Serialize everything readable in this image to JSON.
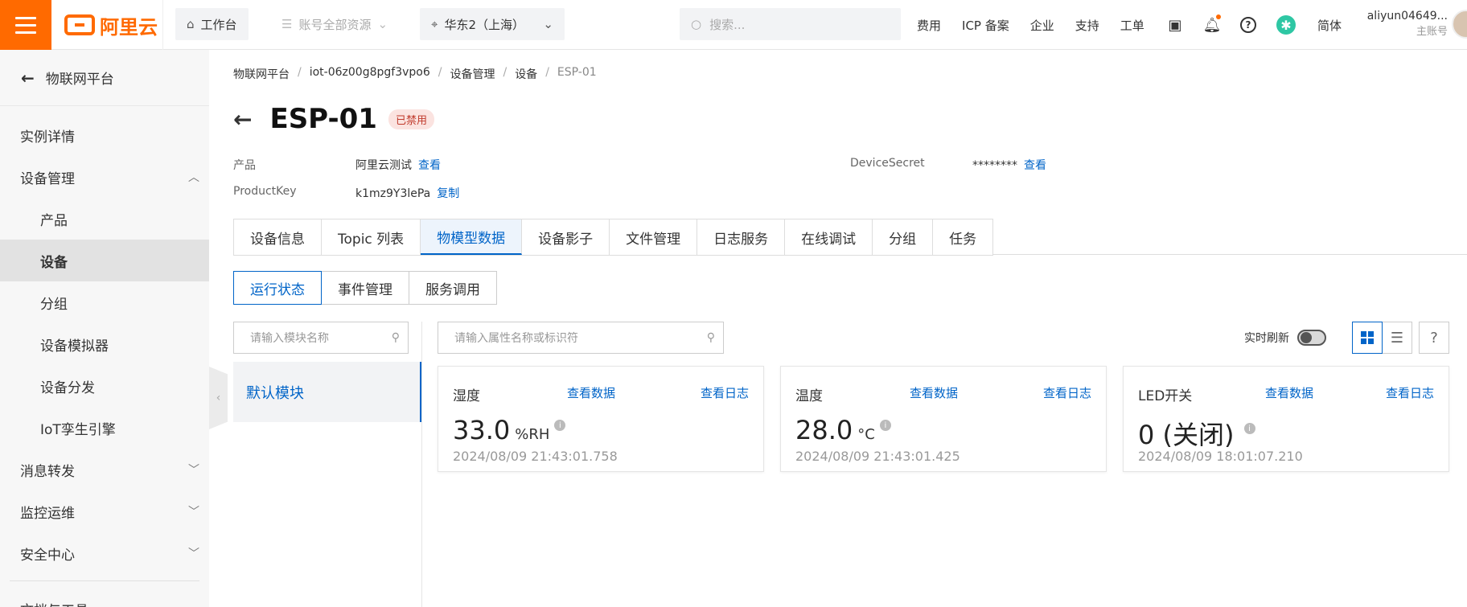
{
  "topbar": {
    "logo_text": "阿里云",
    "workbench": "工作台",
    "resources": "账号全部资源",
    "region": "华东2（上海）",
    "search_placeholder": "搜索...",
    "links": [
      "费用",
      "ICP 备案",
      "企业",
      "支持",
      "工单"
    ],
    "language": "简体",
    "account_name": "aliyun04649...",
    "account_type": "主账号",
    "accent_color": "#ff6a00"
  },
  "sidebar": {
    "back_label": "物联网平台",
    "items": [
      {
        "label": "实例详情"
      },
      {
        "label": "设备管理",
        "expanded": true
      },
      {
        "label": "产品"
      },
      {
        "label": "设备",
        "active": true
      },
      {
        "label": "分组"
      },
      {
        "label": "设备模拟器"
      },
      {
        "label": "设备分发"
      },
      {
        "label": "IoT孪生引擎"
      },
      {
        "label": "消息转发"
      },
      {
        "label": "监控运维"
      },
      {
        "label": "安全中心"
      },
      {
        "label": "文档与工具"
      }
    ]
  },
  "breadcrumb": [
    "物联网平台",
    "iot-06z00g8pgf3vpo6",
    "设备管理",
    "设备",
    "ESP-01"
  ],
  "device": {
    "title": "ESP-01",
    "status": "已禁用",
    "product_label": "产品",
    "product_value": "阿里云测试",
    "product_link": "查看",
    "productkey_label": "ProductKey",
    "productkey_value": "k1mz9Y3lePa",
    "productkey_link": "复制",
    "secret_label": "DeviceSecret",
    "secret_value": "********",
    "secret_link": "查看"
  },
  "tabs": [
    "设备信息",
    "Topic 列表",
    "物模型数据",
    "设备影子",
    "文件管理",
    "日志服务",
    "在线调试",
    "分组",
    "任务"
  ],
  "active_tab": "物模型数据",
  "subtabs": [
    "运行状态",
    "事件管理",
    "服务调用"
  ],
  "module_search_placeholder": "请输入模块名称",
  "module_selected": "默认模块",
  "property_search_placeholder": "请输入属性名称或标识符",
  "realtime_refresh_label": "实时刷新",
  "help_label": "?",
  "cards": [
    {
      "name": "湿度",
      "view_data": "查看数据",
      "view_log": "查看日志",
      "value": "33.0",
      "unit": "%RH",
      "timestamp": "2024/08/09 21:43:01.758"
    },
    {
      "name": "温度",
      "view_data": "查看数据",
      "view_log": "查看日志",
      "value": "28.0",
      "unit": "°C",
      "timestamp": "2024/08/09 21:43:01.425"
    },
    {
      "name": "LED开关",
      "view_data": "查看数据",
      "view_log": "查看日志",
      "value": "0 (关闭)",
      "unit": "",
      "timestamp": "2024/08/09 18:01:07.210"
    }
  ],
  "link_color": "#0064c8"
}
